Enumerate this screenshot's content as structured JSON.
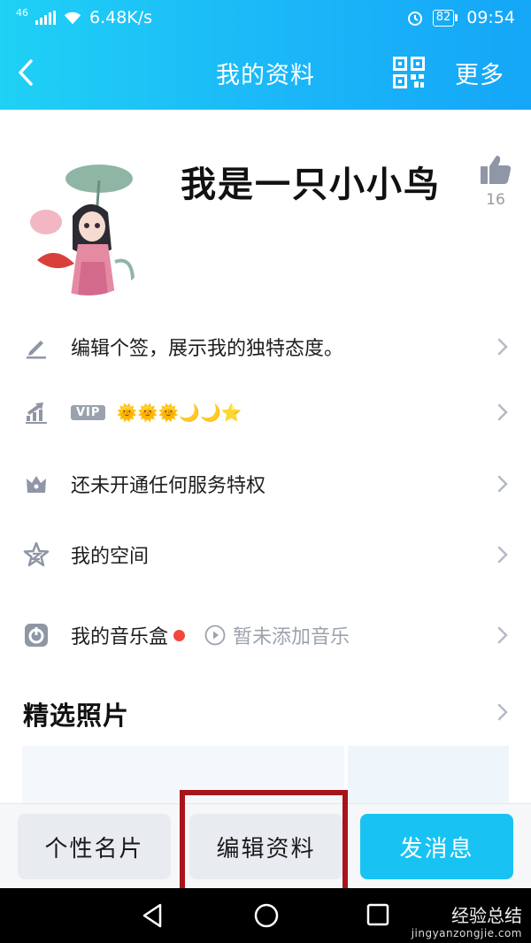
{
  "status_bar": {
    "network": "46",
    "speed": "6.48K/s",
    "battery": "82",
    "time": "09:54"
  },
  "nav": {
    "title": "我的资料",
    "more": "更多"
  },
  "profile": {
    "nickname": "我是一只小小鸟",
    "likes": "16"
  },
  "rows": {
    "signature": "编辑个签，展示我的独特态度。",
    "vip_tag": "VIP",
    "vip_level": "🌞🌞🌞🌙🌙⭐",
    "privilege": "还未开通任何服务特权",
    "space": "我的空间",
    "music": "我的音乐盒",
    "music_sub": "暂未添加音乐"
  },
  "photos": {
    "title": "精选照片"
  },
  "actions": {
    "card": "个性名片",
    "edit": "编辑资料",
    "message": "发消息"
  },
  "watermark": {
    "line1": "经验总结",
    "line2": "jingyanzongjie.com"
  },
  "colors": {
    "accent": "#18c3f4",
    "header_start": "#1fd1f5",
    "header_end": "#14a6f7",
    "highlight_box": "#a81419",
    "music_dot": "#f2473e"
  }
}
